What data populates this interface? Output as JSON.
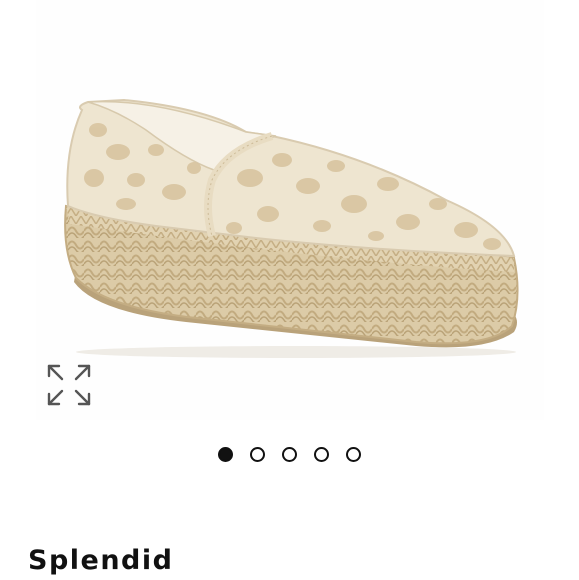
{
  "product": {
    "brand": "Splendid",
    "image_icon": "espadrille-shoe-image"
  },
  "gallery": {
    "expand_icon": "expand-arrows-icon",
    "dots": [
      {
        "active": true
      },
      {
        "active": false
      },
      {
        "active": false
      },
      {
        "active": false
      },
      {
        "active": false
      }
    ]
  },
  "colors": {
    "dot_active": "#111111",
    "text": "#111111",
    "shoe_canvas": "#eee5d0",
    "leopard_spot": "#d8c4a0",
    "jute": "#d6c39c"
  }
}
